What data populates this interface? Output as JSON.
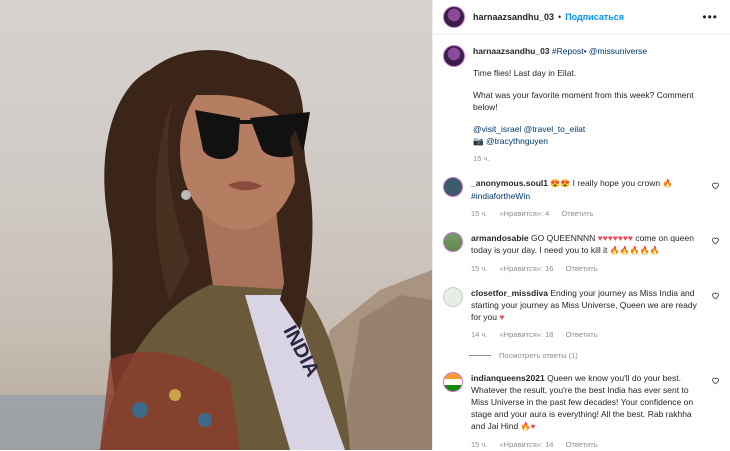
{
  "header": {
    "username": "harnaazsandhu_03",
    "dot": "•",
    "follow_label": "Подписаться",
    "more_label": "•••"
  },
  "caption": {
    "username": "harnaazsandhu_03",
    "repost": "#Repost•",
    "mention": "@missuniverse",
    "line1": "Time flies! Last day in Eilat.",
    "line2": "What was your favorite moment from this week? Comment below!",
    "tags": "@visit_israel @travel_to_eilat",
    "camera": "📷",
    "photographer": "@tracythnguyen",
    "time": "15 ч."
  },
  "photo": {
    "sash_text": "INDIA"
  },
  "comments": [
    {
      "username": "_anonymous.soul1",
      "text_emoji": "😍😍",
      "text": "I really hope you crown",
      "emoji_end": "🔥",
      "hashtag": "#indiafortheWin",
      "time": "15 ч.",
      "likes": "«Нравится»: 4",
      "reply": "Ответить"
    },
    {
      "username": "armandosabie",
      "text": "GO QUEENNNN",
      "hearts": "♥♥♥♥♥♥♥",
      "text2": "come on queen today is your day. I need you to kill it",
      "fire": "🔥🔥🔥🔥🔥",
      "time": "15 ч.",
      "likes": "«Нравится»: 16",
      "reply": "Ответить"
    },
    {
      "username": "closetfor_missdiva",
      "text": "Ending your journey as Miss India and starting your journey as Miss Universe, Queen we are ready for you",
      "heart": "♥",
      "time": "14 ч.",
      "likes": "«Нравится»: 18",
      "reply": "Ответить",
      "view_replies": "Посмотреть ответы (1)"
    },
    {
      "username": "indianqueens2021",
      "text": "Queen we know you'll do your best. Whatever the result, you're the best India has ever sent to Miss Universe in the past few decades! Your confidence on stage and your aura is everything! All the best. Rab rakhha and Jai Hind",
      "emoji_end": "🔥♥",
      "time": "15 ч.",
      "likes": "«Нравится»: 14",
      "reply": "Ответить"
    }
  ]
}
